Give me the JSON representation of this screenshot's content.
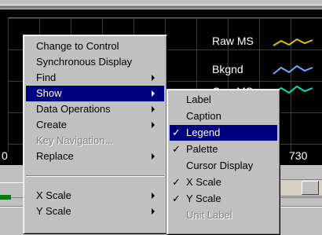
{
  "chart": {
    "legend": [
      {
        "label": "Raw MS",
        "color": "#e0c000"
      },
      {
        "label": "Bkgnd",
        "color": "#66aaff"
      },
      {
        "label": "Corr MS",
        "color": "#00e0c0"
      }
    ],
    "x_tick_labels": [
      "0",
      "730"
    ]
  },
  "context_menu": {
    "items": [
      {
        "label": "Change to Control",
        "submenu": false,
        "state": "normal"
      },
      {
        "label": "Synchronous Display",
        "submenu": false,
        "state": "normal"
      },
      {
        "label": "Find",
        "submenu": true,
        "state": "normal"
      },
      {
        "label": "Show",
        "submenu": true,
        "state": "selected"
      },
      {
        "label": "Data Operations",
        "submenu": true,
        "state": "normal"
      },
      {
        "label": "Create",
        "submenu": true,
        "state": "normal"
      },
      {
        "label": "Key Navigation...",
        "submenu": false,
        "state": "disabled"
      },
      {
        "label": "Replace",
        "submenu": true,
        "state": "normal"
      },
      {
        "label": "X Scale",
        "submenu": true,
        "state": "normal"
      },
      {
        "label": "Y Scale",
        "submenu": true,
        "state": "normal"
      }
    ]
  },
  "show_submenu": {
    "check_glyph": "✓",
    "items": [
      {
        "label": "Label",
        "checked": false,
        "state": "normal"
      },
      {
        "label": "Caption",
        "checked": false,
        "state": "normal"
      },
      {
        "label": "Legend",
        "checked": true,
        "state": "selected"
      },
      {
        "label": "Palette",
        "checked": true,
        "state": "normal"
      },
      {
        "label": "Cursor Display",
        "checked": false,
        "state": "normal"
      },
      {
        "label": "X Scale",
        "checked": true,
        "state": "normal"
      },
      {
        "label": "Y Scale",
        "checked": true,
        "state": "normal"
      },
      {
        "label": "Unit Label",
        "checked": false,
        "state": "disabled"
      }
    ]
  },
  "colors": {
    "menu_bg": "#c0c0c0",
    "highlight": "#000080",
    "chart_bg": "#000000"
  }
}
